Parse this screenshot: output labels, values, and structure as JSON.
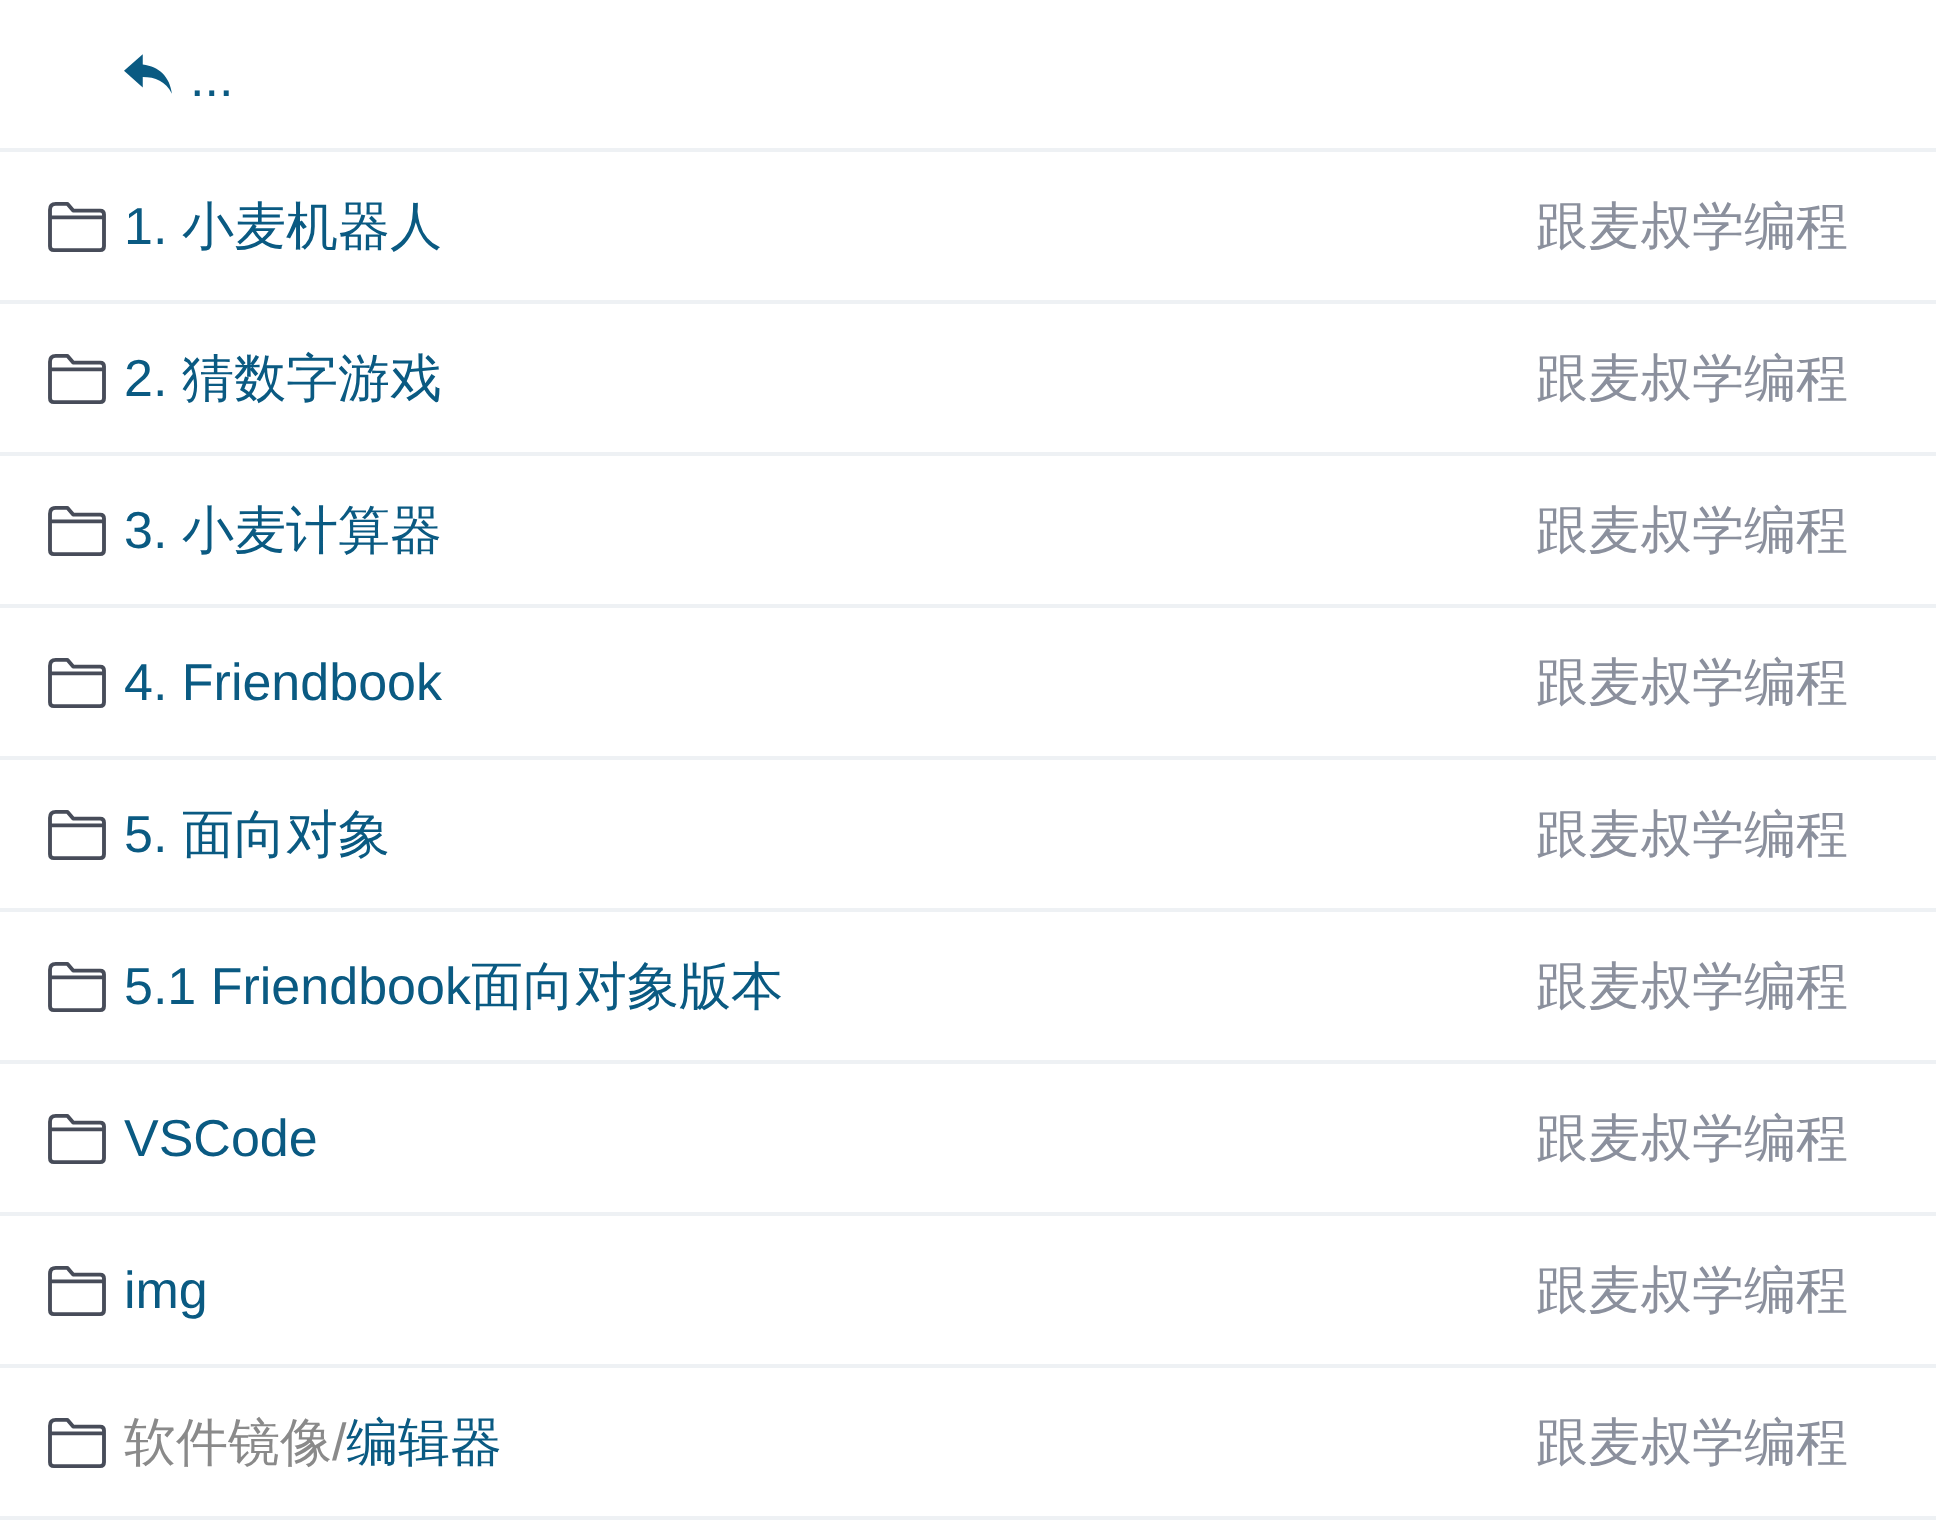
{
  "header": {
    "parent_label": "..."
  },
  "entries": [
    {
      "name": "1. 小麦机器人",
      "description": "跟麦叔学编程"
    },
    {
      "name": "2. 猜数字游戏",
      "description": "跟麦叔学编程"
    },
    {
      "name": "3. 小麦计算器",
      "description": "跟麦叔学编程"
    },
    {
      "name": "4. Friendbook",
      "description": "跟麦叔学编程"
    },
    {
      "name": "5. 面向对象",
      "description": "跟麦叔学编程"
    },
    {
      "name": "5.1 Friendbook面向对象版本",
      "description": "跟麦叔学编程"
    },
    {
      "name": "VSCode",
      "description": "跟麦叔学编程"
    },
    {
      "name": "img",
      "description": "跟麦叔学编程"
    },
    {
      "path_prefix": "软件镜像/",
      "name": "编辑器",
      "description": "跟麦叔学编程"
    }
  ]
}
